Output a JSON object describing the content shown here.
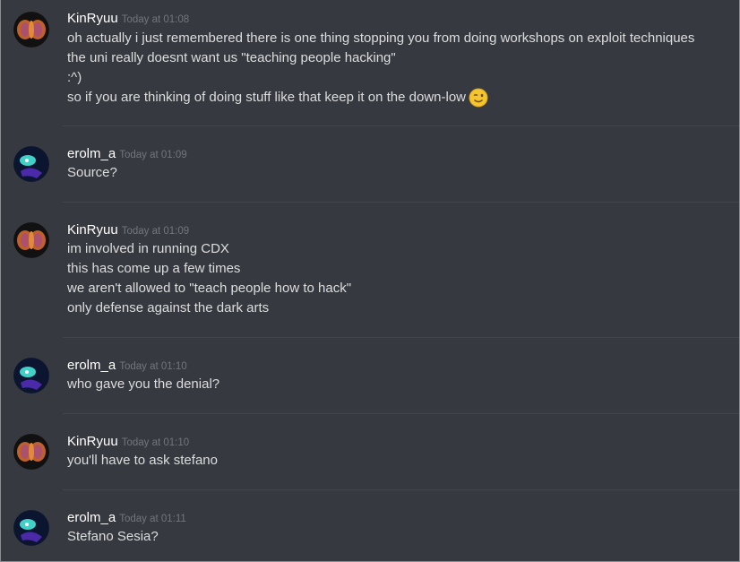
{
  "messages": [
    {
      "user": "KinRyuu",
      "time": "Today at 01:08",
      "avatar": "kinryuu-avatar",
      "lines": [
        "oh actually i just remembered there is one thing stopping you from doing workshops on exploit techniques",
        "the uni really doesnt want us \"teaching people hacking\"",
        ":^)",
        "so if you are thinking of doing stuff like that keep it on the down-low"
      ],
      "emoji": "winking-face-emoji"
    },
    {
      "user": "erolm_a",
      "time": "Today at 01:09",
      "avatar": "erolm-avatar",
      "lines": [
        "Source?"
      ]
    },
    {
      "user": "KinRyuu",
      "time": "Today at 01:09",
      "avatar": "kinryuu-avatar",
      "lines": [
        "im involved in running CDX",
        "this has come up a few times",
        "we aren't allowed to \"teach people how to hack\"",
        "only defense against the dark arts"
      ]
    },
    {
      "user": "erolm_a",
      "time": "Today at 01:10",
      "avatar": "erolm-avatar",
      "lines": [
        "who gave you the denial?"
      ]
    },
    {
      "user": "KinRyuu",
      "time": "Today at 01:10",
      "avatar": "kinryuu-avatar",
      "lines": [
        "you'll have to ask stefano"
      ]
    },
    {
      "user": "erolm_a",
      "time": "Today at 01:11",
      "avatar": "erolm-avatar",
      "lines": [
        "Stefano Sesia?"
      ]
    }
  ],
  "colors": {
    "background": "#36393f",
    "username": "#ffffff",
    "timestamp": "#72767d",
    "text": "#dcddde",
    "divider": "#42454a"
  }
}
